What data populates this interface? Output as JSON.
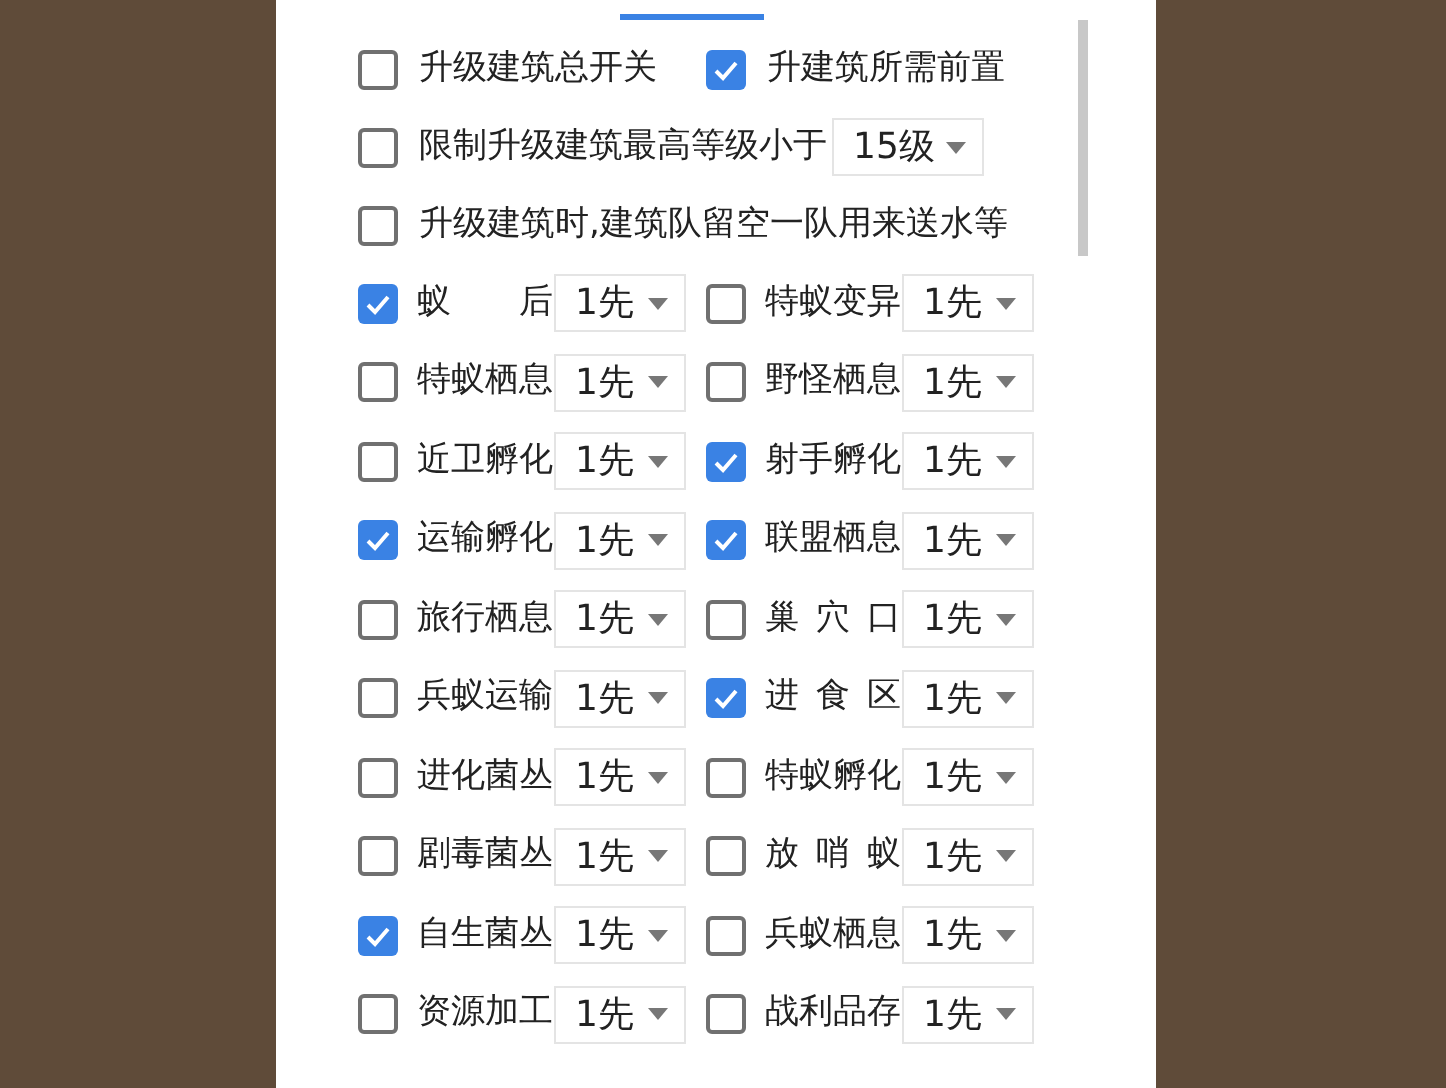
{
  "options_row": [
    {
      "label": "升级建筑总开关",
      "checked": false
    },
    {
      "label": "升建筑所需前置",
      "checked": true
    }
  ],
  "level_limit": {
    "label": "限制升级建筑最高等级小于",
    "checked": false,
    "value": "15级"
  },
  "reserve_option": {
    "label": "升级建筑时,建筑队留空一队用来送水等",
    "checked": false
  },
  "buildings": [
    {
      "label": "蚁 后",
      "checked": true,
      "priority": "1先"
    },
    {
      "label": "特蚁变异",
      "checked": false,
      "priority": "1先"
    },
    {
      "label": "特蚁栖息",
      "checked": false,
      "priority": "1先"
    },
    {
      "label": "野怪栖息",
      "checked": false,
      "priority": "1先"
    },
    {
      "label": "近卫孵化",
      "checked": false,
      "priority": "1先"
    },
    {
      "label": "射手孵化",
      "checked": true,
      "priority": "1先"
    },
    {
      "label": "运输孵化",
      "checked": true,
      "priority": "1先"
    },
    {
      "label": "联盟栖息",
      "checked": true,
      "priority": "1先"
    },
    {
      "label": "旅行栖息",
      "checked": false,
      "priority": "1先"
    },
    {
      "label": "巢 穴 口",
      "checked": false,
      "priority": "1先"
    },
    {
      "label": "兵蚁运输",
      "checked": false,
      "priority": "1先"
    },
    {
      "label": "进 食 区",
      "checked": true,
      "priority": "1先"
    },
    {
      "label": "进化菌丛",
      "checked": false,
      "priority": "1先"
    },
    {
      "label": "特蚁孵化",
      "checked": false,
      "priority": "1先"
    },
    {
      "label": "剧毒菌丛",
      "checked": false,
      "priority": "1先"
    },
    {
      "label": "放 哨 蚁",
      "checked": false,
      "priority": "1先"
    },
    {
      "label": "自生菌丛",
      "checked": true,
      "priority": "1先"
    },
    {
      "label": "兵蚁栖息",
      "checked": false,
      "priority": "1先"
    },
    {
      "label": "资源加工",
      "checked": false,
      "priority": "1先"
    },
    {
      "label": "战利品存",
      "checked": false,
      "priority": "1先"
    }
  ]
}
